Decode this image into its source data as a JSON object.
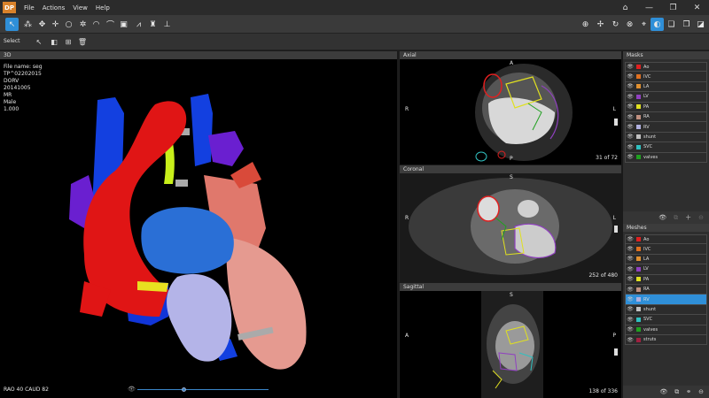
{
  "app": {
    "logo": "DP",
    "menu": [
      "File",
      "Actions",
      "View",
      "Help"
    ]
  },
  "toolbar": {
    "left_icons": [
      "pointer-icon",
      "nodes-icon",
      "move-icon",
      "crosshair-icon",
      "circle-icon",
      "gear-icon",
      "dome-icon",
      "arch-icon",
      "image-icon",
      "waveform-icon",
      "building-icon",
      "stamp-icon"
    ],
    "right_icons": [
      "zoom-icon",
      "pan-icon",
      "rotate-icon",
      "target-icon",
      "fit-icon",
      "contrast-icon",
      "layers-icon",
      "layers-alt-icon"
    ]
  },
  "subbar": {
    "label": "Select"
  },
  "view3d": {
    "header": "3D",
    "info": [
      "File name: seg",
      "TP^02202015",
      "DORV",
      "20141005",
      "MR",
      "Male",
      "1.000"
    ],
    "orientation": "RAO 40   CAUD  82",
    "slider_value": 0.36
  },
  "views": {
    "axial": {
      "header": "Axial",
      "top": "A",
      "left": "R",
      "right": "L",
      "bottom": "P",
      "count": "31 of 72"
    },
    "coronal": {
      "header": "Coronal",
      "top": "S",
      "left": "R",
      "right": "L",
      "count": "252 of 480"
    },
    "sagittal": {
      "header": "Sagittal",
      "top": "S",
      "left": "A",
      "right": "P",
      "count": "138 of 336"
    }
  },
  "masks": {
    "header": "Masks",
    "items": [
      {
        "name": "Ao",
        "color": "#e02020"
      },
      {
        "name": "IVC",
        "color": "#e07020"
      },
      {
        "name": "LA",
        "color": "#e09030"
      },
      {
        "name": "LV",
        "color": "#9040c0"
      },
      {
        "name": "PA",
        "color": "#e0e020"
      },
      {
        "name": "RA",
        "color": "#c09080"
      },
      {
        "name": "RV",
        "color": "#b0b0e0"
      },
      {
        "name": "shunt",
        "color": "#c0c0c0"
      },
      {
        "name": "SVC",
        "color": "#30c0c0"
      },
      {
        "name": "valves",
        "color": "#20a020"
      }
    ]
  },
  "meshes": {
    "header": "Meshes",
    "items": [
      {
        "name": "Ao",
        "color": "#e02020",
        "selected": false
      },
      {
        "name": "IVC",
        "color": "#e07020",
        "selected": false
      },
      {
        "name": "LA",
        "color": "#e09030",
        "selected": false
      },
      {
        "name": "LV",
        "color": "#9040c0",
        "selected": false
      },
      {
        "name": "PA",
        "color": "#e0e020",
        "selected": false
      },
      {
        "name": "RA",
        "color": "#c09080",
        "selected": false
      },
      {
        "name": "RV",
        "color": "#b0b0e0",
        "selected": true
      },
      {
        "name": "shunt",
        "color": "#c0c0c0",
        "selected": false
      },
      {
        "name": "SVC",
        "color": "#30c0c0",
        "selected": false
      },
      {
        "name": "valves",
        "color": "#20a020",
        "selected": false
      },
      {
        "name": "struts",
        "color": "#a02040",
        "selected": false
      }
    ]
  }
}
